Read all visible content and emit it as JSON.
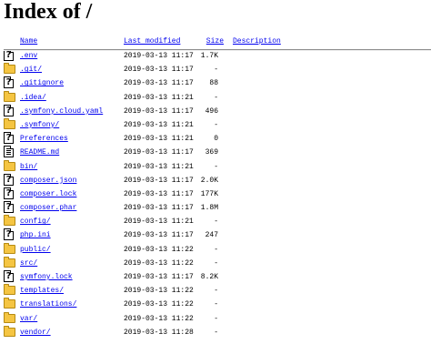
{
  "title": "Index of /",
  "columns": {
    "name": "Name",
    "last_modified": "Last modified",
    "size": "Size",
    "description": "Description"
  },
  "entries": [
    {
      "name": ".env",
      "date": "2019-03-13 11:17",
      "size": "1.7K",
      "icon": "unknown-file-icon"
    },
    {
      "name": ".git/",
      "date": "2019-03-13 11:17",
      "size": "-",
      "icon": "folder-icon"
    },
    {
      "name": ".gitignore",
      "date": "2019-03-13 11:17",
      "size": "88",
      "icon": "unknown-file-icon"
    },
    {
      "name": ".idea/",
      "date": "2019-03-13 11:21",
      "size": "-",
      "icon": "folder-icon"
    },
    {
      "name": ".symfony.cloud.yaml",
      "date": "2019-03-13 11:17",
      "size": "496",
      "icon": "unknown-file-icon"
    },
    {
      "name": ".symfony/",
      "date": "2019-03-13 11:21",
      "size": "-",
      "icon": "folder-icon"
    },
    {
      "name": "Preferences",
      "date": "2019-03-13 11:21",
      "size": "0",
      "icon": "unknown-file-icon"
    },
    {
      "name": "README.md",
      "date": "2019-03-13 11:17",
      "size": "369",
      "icon": "text-file-icon"
    },
    {
      "name": "bin/",
      "date": "2019-03-13 11:21",
      "size": "-",
      "icon": "folder-icon"
    },
    {
      "name": "composer.json",
      "date": "2019-03-13 11:17",
      "size": "2.0K",
      "icon": "unknown-file-icon"
    },
    {
      "name": "composer.lock",
      "date": "2019-03-13 11:17",
      "size": "177K",
      "icon": "unknown-file-icon"
    },
    {
      "name": "composer.phar",
      "date": "2019-03-13 11:17",
      "size": "1.8M",
      "icon": "unknown-file-icon"
    },
    {
      "name": "config/",
      "date": "2019-03-13 11:21",
      "size": "-",
      "icon": "folder-icon"
    },
    {
      "name": "php.ini",
      "date": "2019-03-13 11:17",
      "size": "247",
      "icon": "unknown-file-icon"
    },
    {
      "name": "public/",
      "date": "2019-03-13 11:22",
      "size": "-",
      "icon": "folder-icon"
    },
    {
      "name": "src/",
      "date": "2019-03-13 11:22",
      "size": "-",
      "icon": "folder-icon"
    },
    {
      "name": "symfony.lock",
      "date": "2019-03-13 11:17",
      "size": "8.2K",
      "icon": "unknown-file-icon"
    },
    {
      "name": "templates/",
      "date": "2019-03-13 11:22",
      "size": "-",
      "icon": "folder-icon"
    },
    {
      "name": "translations/",
      "date": "2019-03-13 11:22",
      "size": "-",
      "icon": "folder-icon"
    },
    {
      "name": "var/",
      "date": "2019-03-13 11:22",
      "size": "-",
      "icon": "folder-icon"
    },
    {
      "name": "vendor/",
      "date": "2019-03-13 11:28",
      "size": "-",
      "icon": "folder-icon"
    }
  ],
  "colors": {
    "link": "#0000ee",
    "text": "#000000",
    "background": "#ffffff"
  }
}
